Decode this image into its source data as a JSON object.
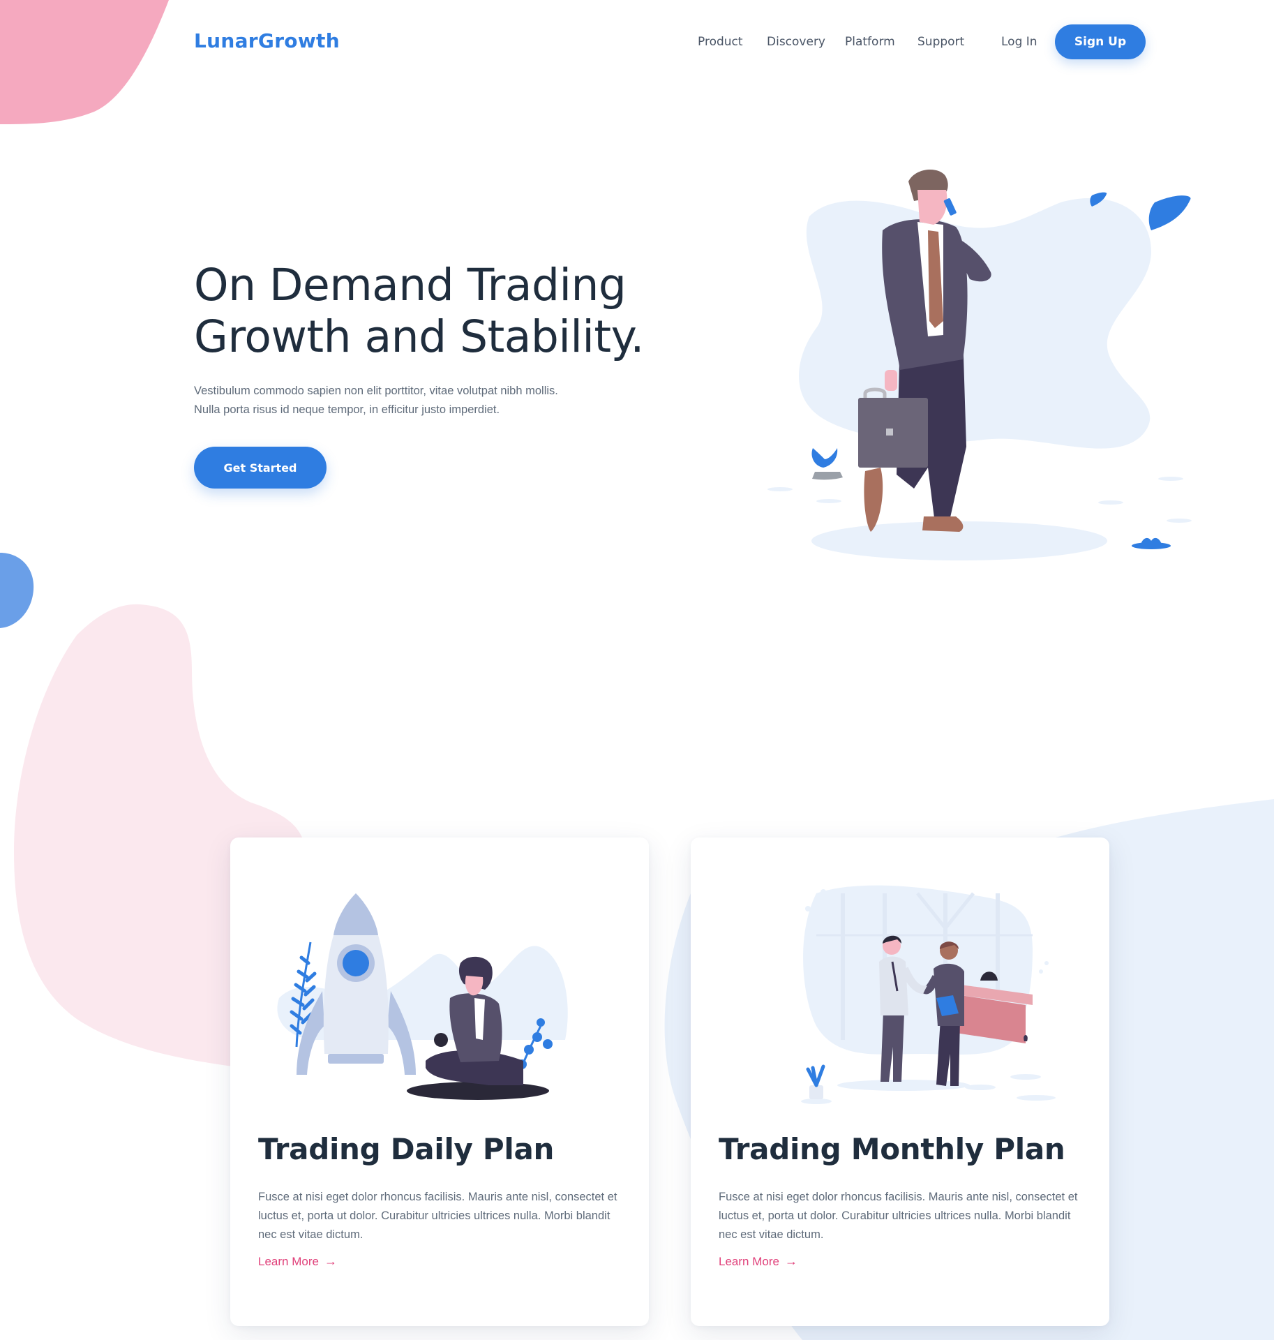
{
  "brand": {
    "name": "LunarGrowth",
    "color": "#2f7de1"
  },
  "nav": {
    "items": [
      "Product",
      "Discovery",
      "Platform",
      "Support"
    ],
    "login": "Log In",
    "signup": "Sign Up"
  },
  "hero": {
    "title_line1": "On Demand Trading",
    "title_line2": "Growth and Stability.",
    "text_line1": "Vestibulum commodo sapien non elit porttitor, vitae volutpat nibh mollis.",
    "text_line2": "Nulla porta risus id neque tempor, in efficitur justo imperdiet.",
    "cta": "Get Started"
  },
  "cards": [
    {
      "title": "Trading Daily Plan",
      "text": "Fusce at nisi eget dolor rhoncus facilisis. Mauris ante nisl, consectet et luctus et, porta ut dolor. Curabitur ultricies ultrices nulla. Morbi blandit nec est vitae dictum.",
      "link": "Learn More"
    },
    {
      "title": "Trading Monthly Plan",
      "text": "Fusce at nisi eget dolor rhoncus facilisis. Mauris ante nisl, consectet et luctus et, porta ut dolor. Curabitur ultricies ultrices nulla. Morbi blandit nec est vitae dictum.",
      "link": "Learn More"
    }
  ],
  "colors": {
    "primary": "#2f7de1",
    "accent_link": "#e0407a",
    "heading": "#1f2d3d",
    "body_text": "#5f6b7a",
    "blob_pink": "#f5a9bf",
    "blob_light_pink": "#fbe8ee",
    "blob_light_blue": "#e9f1fb"
  }
}
